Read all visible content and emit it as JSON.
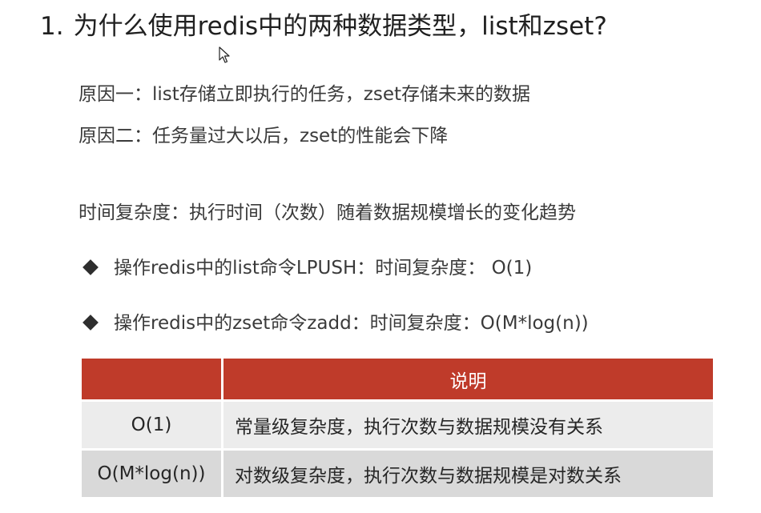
{
  "heading": {
    "number": "1.",
    "text": "为什么使用redis中的两种数据类型，list和zset?"
  },
  "reasons": [
    "原因一：list存储立即执行的任务，zset存储未来的数据",
    "原因二：任务量过大以后，zset的性能会下降"
  ],
  "complexity_definition": "时间复杂度：执行时间（次数）随着数据规模增长的变化趋势",
  "bullets": [
    "操作redis中的list命令LPUSH：时间复杂度： O(1)",
    "操作redis中的zset命令zadd：时间复杂度：O(M*log(n))"
  ],
  "table": {
    "headers": [
      "",
      "说明"
    ],
    "rows": [
      [
        "O(1)",
        "常量级复杂度，执行次数与数据规模没有关系"
      ],
      [
        "O(M*log(n))",
        "对数级复杂度，执行次数与数据规模是对数关系"
      ]
    ]
  },
  "colors": {
    "header_bg": "#bf3b2a",
    "row1_bg": "#ececec",
    "row2_bg": "#d9d9d9"
  },
  "icons": [
    "mouse-cursor-icon",
    "diamond-bullet-icon"
  ]
}
